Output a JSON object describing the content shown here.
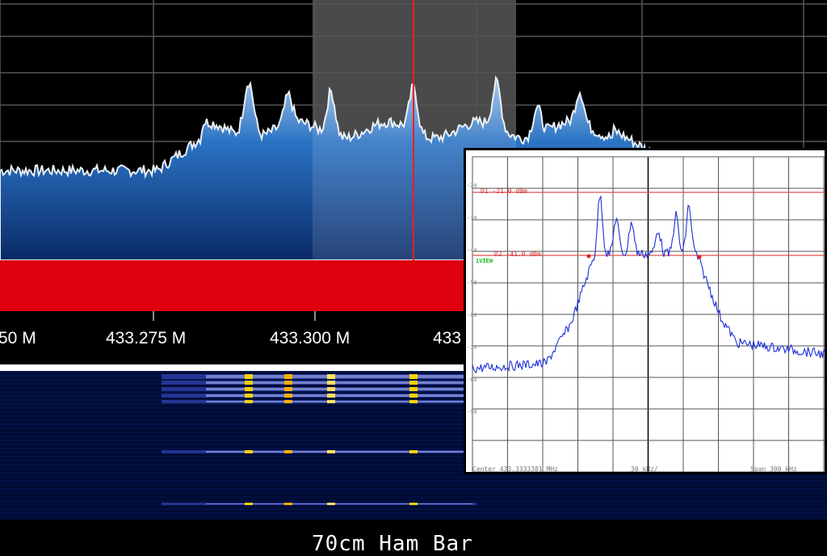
{
  "spectrum": {
    "band_label": "70cm Ham Bar",
    "freq_labels": [
      "50 M",
      "433.275 M",
      "433.300 M",
      "433"
    ],
    "colors": {
      "fill": "#1f5fa8",
      "band": "#e10010",
      "tuner": "#ff2020"
    }
  },
  "analyzer": {
    "marker1": "D1 -21.0 dBm",
    "marker2": "D2 -41.0 dBm",
    "trace_label": "1VIEW",
    "left_ticks": [
      "-20",
      "-30",
      "-40",
      "-50",
      "-60",
      "-70",
      "-80",
      "-90"
    ],
    "footer_center": "Center 433.3333381 MHz",
    "footer_div": "30 kHz/",
    "footer_span": "Span 300 kHz"
  }
}
